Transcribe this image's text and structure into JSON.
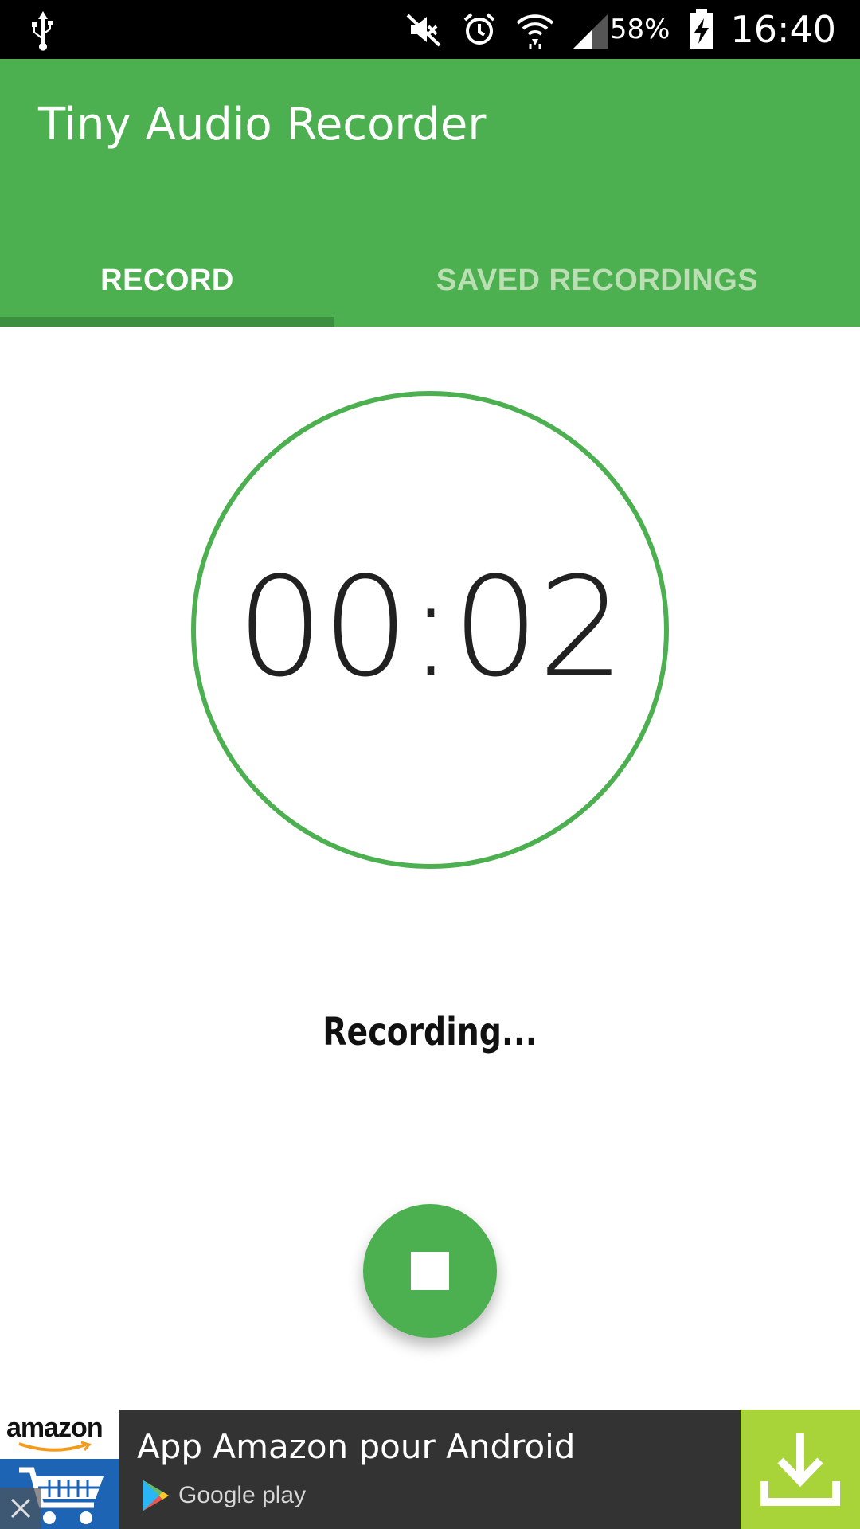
{
  "status_bar": {
    "icons": [
      "usb-icon",
      "mute-icon",
      "alarm-icon",
      "wifi-icon",
      "signal-icon",
      "battery-charging-icon"
    ],
    "battery_percent": "58%",
    "time": "16:40"
  },
  "app": {
    "title": "Tiny Audio Recorder",
    "accent_color": "#4caf50"
  },
  "tabs": [
    {
      "label": "RECORD",
      "selected": true
    },
    {
      "label": "SAVED RECORDINGS",
      "selected": false
    }
  ],
  "recorder": {
    "timer": "00:02",
    "status": "Recording...",
    "stop_icon": "stop-icon"
  },
  "ad": {
    "brand": "amazon",
    "title": "App Amazon pour Android",
    "store": "Google play",
    "download_color": "#a8d43a"
  }
}
